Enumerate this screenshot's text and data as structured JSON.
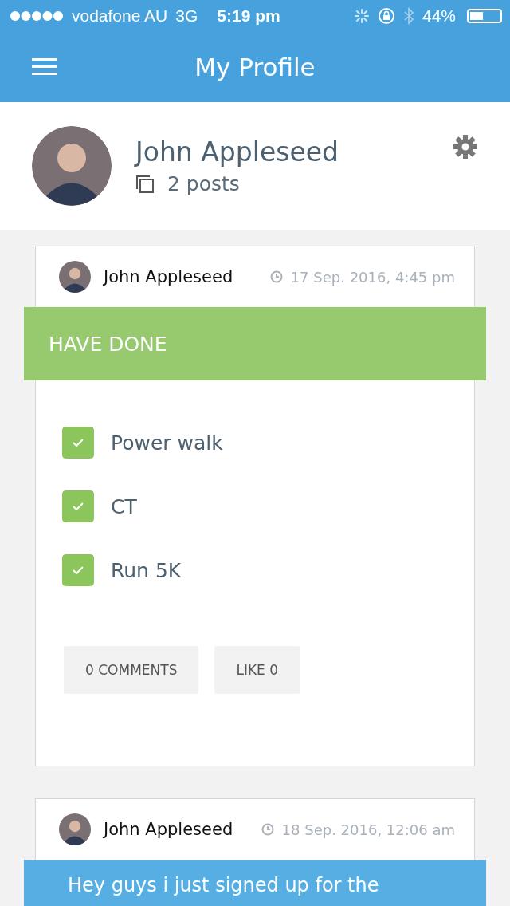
{
  "status_bar": {
    "carrier": "vodafone AU",
    "network": "3G",
    "time": "5:19 pm",
    "battery": "44%"
  },
  "nav": {
    "title": "My Profile"
  },
  "profile": {
    "name": "John Appleseed",
    "posts": "2 posts"
  },
  "posts": [
    {
      "kind": "checklist",
      "author": "John Appleseed",
      "time": "17 Sep. 2016, 4:45 pm",
      "banner": "HAVE DONE",
      "items": [
        {
          "label": "Power walk",
          "checked": true
        },
        {
          "label": "CT",
          "checked": true
        },
        {
          "label": "Run 5K",
          "checked": true
        }
      ],
      "buttons": [
        "0 COMMENTS",
        "LIKE 0"
      ]
    },
    {
      "kind": "text",
      "author": "John Appleseed",
      "time": "18 Sep. 2016, 12:06 am",
      "text": "Hey guys i just signed up for the"
    }
  ]
}
